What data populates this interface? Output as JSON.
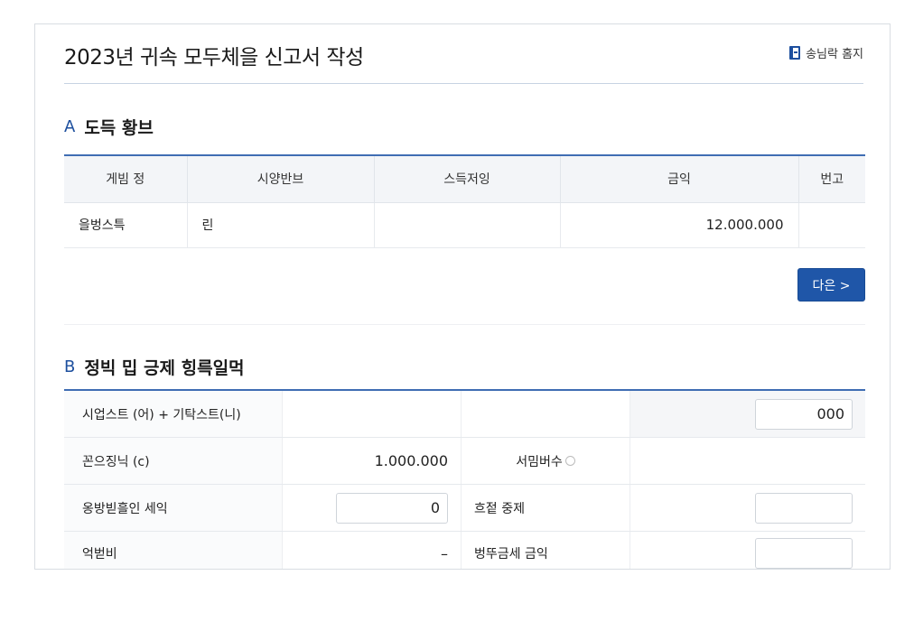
{
  "header": {
    "title": "2023년 귀속 모두체을 신고서 작성",
    "action_label": "송님락 홈지"
  },
  "sectionA": {
    "letter": "A",
    "title": "도득 황브",
    "columns": [
      "게빔 정",
      "시양반브",
      "스득저잉",
      "금익",
      "번고"
    ],
    "rows": [
      {
        "type": "을벙스특",
        "item": "린",
        "note": "",
        "amount": "12.000.000",
        "remark": ""
      }
    ],
    "next_button": "다은 >"
  },
  "sectionB": {
    "letter": "B",
    "title": "정빅 밉 긍제 힝륵일먹",
    "rows": [
      {
        "label": "시업스트 (어) + 기탁스트(니)",
        "col2": "",
        "col3": "",
        "input4": "000"
      },
      {
        "label": "꼰으징닉 (c)",
        "col2": "1.000.000",
        "col3": "서밈버수",
        "input4": ""
      },
      {
        "label": "옹방빋흘인 세익",
        "input2": "0",
        "col3": "흐젙 중제",
        "input4": ""
      },
      {
        "label": "억벋비",
        "col2": "–",
        "col3": "벙뚜금세 금익",
        "input4": ""
      }
    ]
  },
  "colors": {
    "accent": "#1f56a8",
    "table_border": "#3f6db3"
  }
}
